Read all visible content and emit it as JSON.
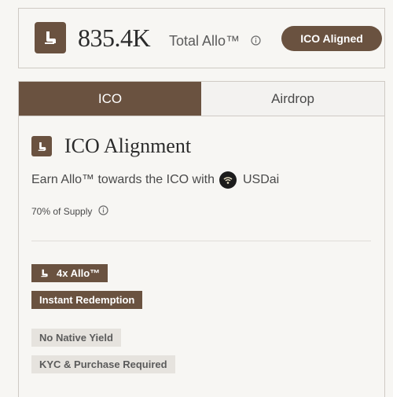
{
  "summary": {
    "total_value": "835.4K",
    "total_label": "Total Allo™",
    "status_badge": "ICO Aligned"
  },
  "tabs": [
    {
      "label": "ICO",
      "active": true
    },
    {
      "label": "Airdrop",
      "active": false
    }
  ],
  "section": {
    "title": "ICO Alignment",
    "description": "Earn Allo™ towards the ICO with",
    "token_label": "USDai",
    "supply": "70% of Supply"
  },
  "tags": {
    "multiplier": "4x Allo™",
    "redemption": "Instant Redemption",
    "yield": "No Native Yield",
    "kyc": "KYC & Purchase Required"
  },
  "colors": {
    "accent": "#6a5240",
    "background": "#f7f6f3",
    "muted_tag": "#e6e3de"
  },
  "icons": {
    "brand": "allo-seat-icon",
    "info": "info-icon",
    "token": "usdai-token-icon"
  }
}
